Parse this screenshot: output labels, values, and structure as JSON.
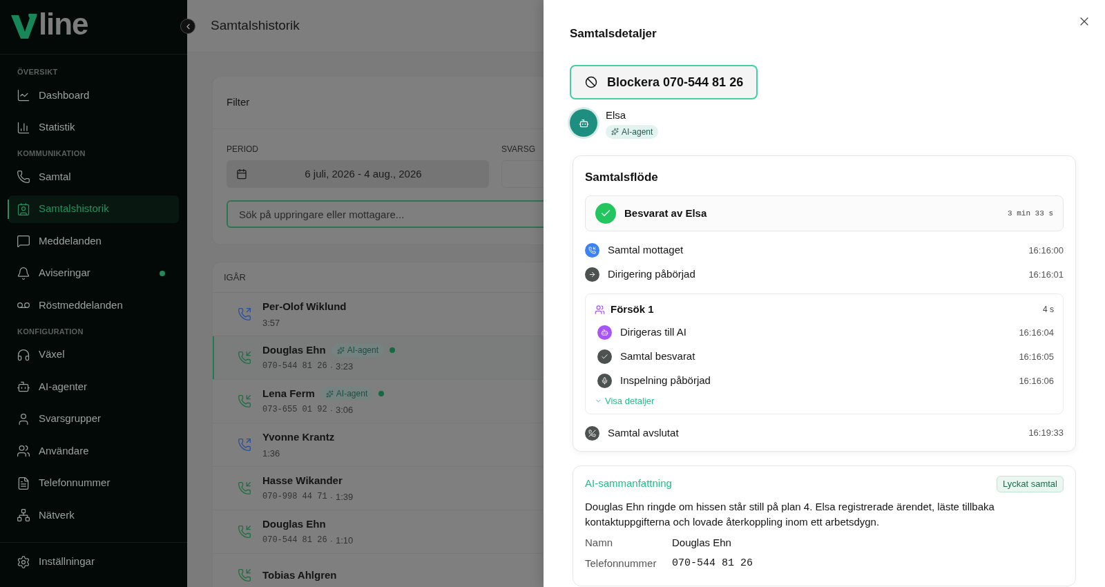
{
  "brand": {
    "logo_text": "line"
  },
  "sidebar": {
    "sections": [
      {
        "heading": "ÖVERSIKT",
        "items": [
          {
            "label": "Dashboard",
            "selected": false,
            "dot": false
          },
          {
            "label": "Statistik",
            "selected": false,
            "dot": false
          }
        ]
      },
      {
        "heading": "KOMMUNIKATION",
        "items": [
          {
            "label": "Samtal",
            "selected": false,
            "dot": false
          },
          {
            "label": "Samtalshistorik",
            "selected": true,
            "dot": false
          },
          {
            "label": "Meddelanden",
            "selected": false,
            "dot": false
          },
          {
            "label": "Aviseringar",
            "selected": false,
            "dot": true
          },
          {
            "label": "Röstmeddelanden",
            "selected": false,
            "dot": false
          }
        ]
      },
      {
        "heading": "KONFIGURATION",
        "items": [
          {
            "label": "Växel",
            "selected": false,
            "dot": false
          },
          {
            "label": "AI-agenter",
            "selected": false,
            "dot": false
          },
          {
            "label": "Svarsgrupper",
            "selected": false,
            "dot": false
          },
          {
            "label": "Användare",
            "selected": false,
            "dot": false
          },
          {
            "label": "Telefonnummer",
            "selected": false,
            "dot": false
          },
          {
            "label": "Nätverk",
            "selected": false,
            "dot": false
          }
        ]
      }
    ],
    "footer_item": {
      "label": "Inställningar",
      "selected": false
    }
  },
  "page_title": "Samtalshistorik",
  "filter": {
    "title": "Filter",
    "period_label": "PERIOD",
    "period_value": "6 juli, 2026 - 4 aug., 2026",
    "group_label": "SVARSG",
    "search_placeholder": "Sök på uppringare eller mottagare..."
  },
  "calls": {
    "group": "IGÅR",
    "separator": "·",
    "rows": [
      {
        "kind": "outgoing",
        "name": "Per-Olof Wiklund",
        "number": null,
        "duration": "3:57",
        "badge": null,
        "dot": false,
        "selected": false
      },
      {
        "kind": "incoming",
        "name": "Douglas Ehn",
        "number": "070-544 81 26",
        "duration": "3:23",
        "badge": "AI-agent",
        "dot": true,
        "selected": true
      },
      {
        "kind": "incoming",
        "name": "Lena Ferm",
        "number": "073-655 01 92",
        "duration": "3:06",
        "badge": "AI-agent",
        "dot": true,
        "selected": false
      },
      {
        "kind": "outgoing",
        "name": "Yvonne Krantz",
        "number": null,
        "duration": "1:36",
        "badge": null,
        "dot": false,
        "selected": false
      },
      {
        "kind": "incoming",
        "name": "Hasse Wikander",
        "number": "070-998 44 71",
        "duration": "1:39",
        "badge": null,
        "dot": false,
        "selected": false
      },
      {
        "kind": "incoming",
        "name": "Douglas Ehn",
        "number": "070-544 81 26",
        "duration": "1:10",
        "badge": null,
        "dot": false,
        "selected": false
      },
      {
        "kind": "incoming",
        "name": "Tobias Ahlgren",
        "number": null,
        "duration": null,
        "badge": null,
        "dot": false,
        "selected": false
      }
    ]
  },
  "drawer": {
    "title": "Samtalsdetaljer",
    "block_button": "Blockera 070-544 81 26",
    "agent": {
      "name": "Elsa",
      "badge": "AI-agent"
    },
    "flow": {
      "title": "Samtalsflöde",
      "summary": {
        "label": "Besvarat av Elsa",
        "duration": "3 min 33 s"
      },
      "events": [
        {
          "kind": "received",
          "label": "Samtal mottaget",
          "time": "16:16:00"
        },
        {
          "kind": "routing",
          "label": "Dirigering påbörjad",
          "time": "16:16:01"
        },
        {
          "kind": "attempt",
          "label": "Försök 1",
          "time": "4 s",
          "details_link": "Visa detaljer",
          "events": [
            {
              "kind": "ai",
              "label": "Dirigeras till AI",
              "time": "16:16:04"
            },
            {
              "kind": "answered",
              "label": "Samtal besvarat",
              "time": "16:16:05"
            },
            {
              "kind": "recording",
              "label": "Inspelning påbörjad",
              "time": "16:16:06"
            }
          ]
        },
        {
          "kind": "ended",
          "label": "Samtal avslutat",
          "time": "16:19:33"
        }
      ]
    },
    "summary": {
      "title": "AI-sammanfattning",
      "outcome": "Lyckat samtal",
      "text": "Douglas Ehn ringde om hissen står still på plan 4. Elsa registrerade ärendet, läste tillbaka kontaktuppgifterna och lovade återkoppling inom ett arbetsdygn.",
      "fields": [
        {
          "label": "Namn",
          "value": "Douglas Ehn"
        },
        {
          "label": "Telefonnummer",
          "value": "070-544 81 26"
        }
      ]
    }
  }
}
